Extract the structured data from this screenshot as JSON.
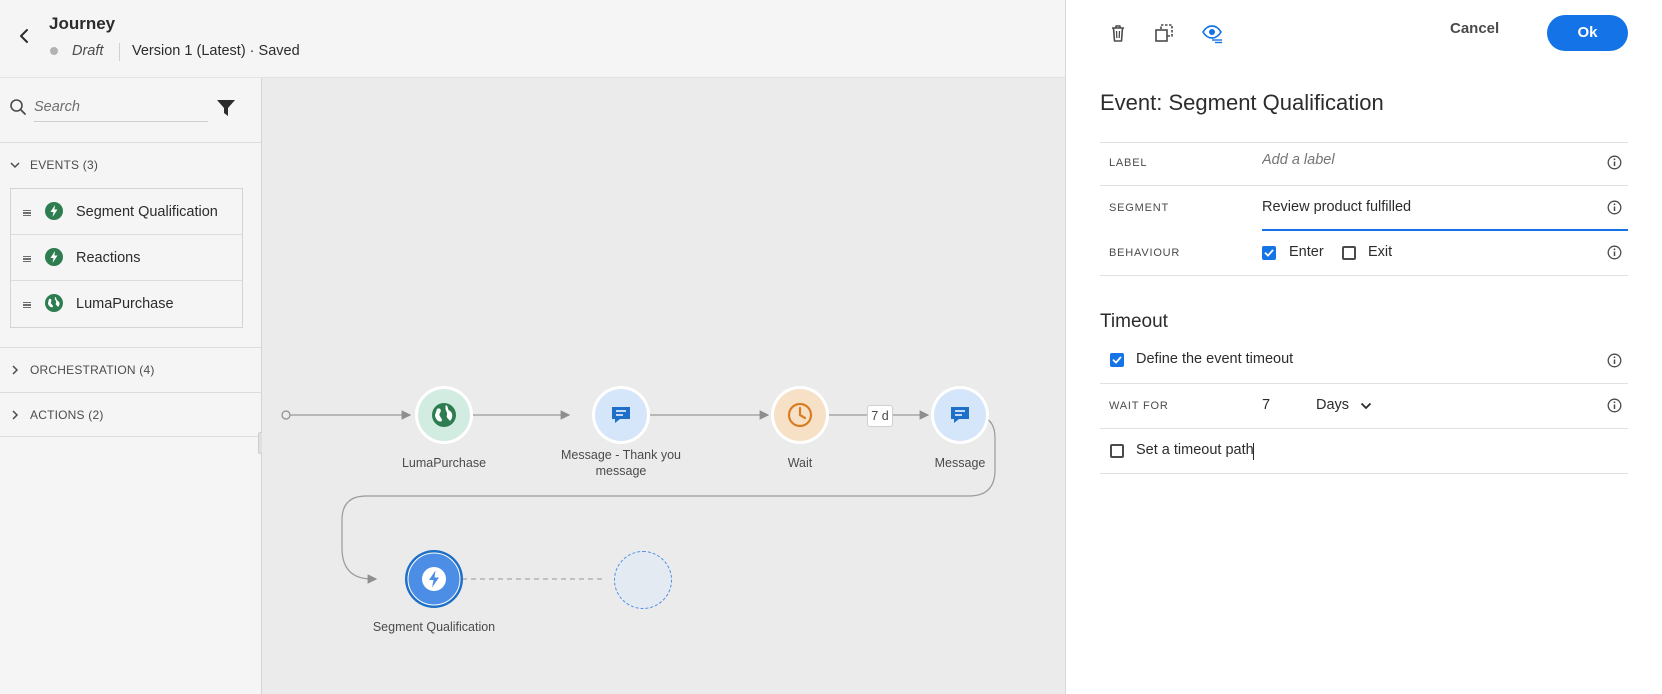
{
  "header": {
    "title": "Journey",
    "status": "Draft",
    "version": "Version 1 (Latest) · Saved"
  },
  "left_panel": {
    "search_placeholder": "Search",
    "sections": {
      "events": {
        "label": "EVENTS (3)",
        "expanded": true
      },
      "orchestration": {
        "label": "ORCHESTRATION (4)",
        "expanded": false
      },
      "actions": {
        "label": "ACTIONS (2)",
        "expanded": false
      }
    },
    "events": [
      {
        "label": "Segment Qualification",
        "icon": "bolt-icon"
      },
      {
        "label": "Reactions",
        "icon": "bolt-icon"
      },
      {
        "label": "LumaPurchase",
        "icon": "globe-icon"
      }
    ]
  },
  "canvas": {
    "nodes": [
      {
        "label": "LumaPurchase",
        "icon": "globe-icon"
      },
      {
        "label": "Message - Thank you message",
        "icon": "message-icon"
      },
      {
        "label": "Wait",
        "icon": "clock-icon"
      },
      {
        "label": "Message",
        "icon": "message-icon"
      },
      {
        "label": "Segment Qualification",
        "icon": "bolt-icon"
      }
    ],
    "wait_badge": "7 d"
  },
  "properties": {
    "toolbar": {
      "cancel_label": "Cancel",
      "ok_label": "Ok"
    },
    "title": "Event: Segment Qualification",
    "fields": {
      "label": {
        "name": "LABEL",
        "placeholder": "Add a label",
        "value": ""
      },
      "segment": {
        "name": "SEGMENT",
        "value": "Review product fulfilled"
      },
      "behaviour": {
        "name": "BEHAVIOUR",
        "enter_label": "Enter",
        "enter_checked": true,
        "exit_label": "Exit",
        "exit_checked": false
      }
    },
    "timeout": {
      "title": "Timeout",
      "define_label": "Define the event timeout",
      "define_checked": true,
      "wait_for_label": "WAIT FOR",
      "wait_value": "7",
      "wait_unit": "Days",
      "timeout_path_label": "Set a timeout path",
      "timeout_path_checked": false
    }
  },
  "colors": {
    "accent": "#1473e6",
    "node_green": "#2d7d51",
    "node_blue": "#1e6fc8",
    "node_orange": "#d97c22"
  }
}
